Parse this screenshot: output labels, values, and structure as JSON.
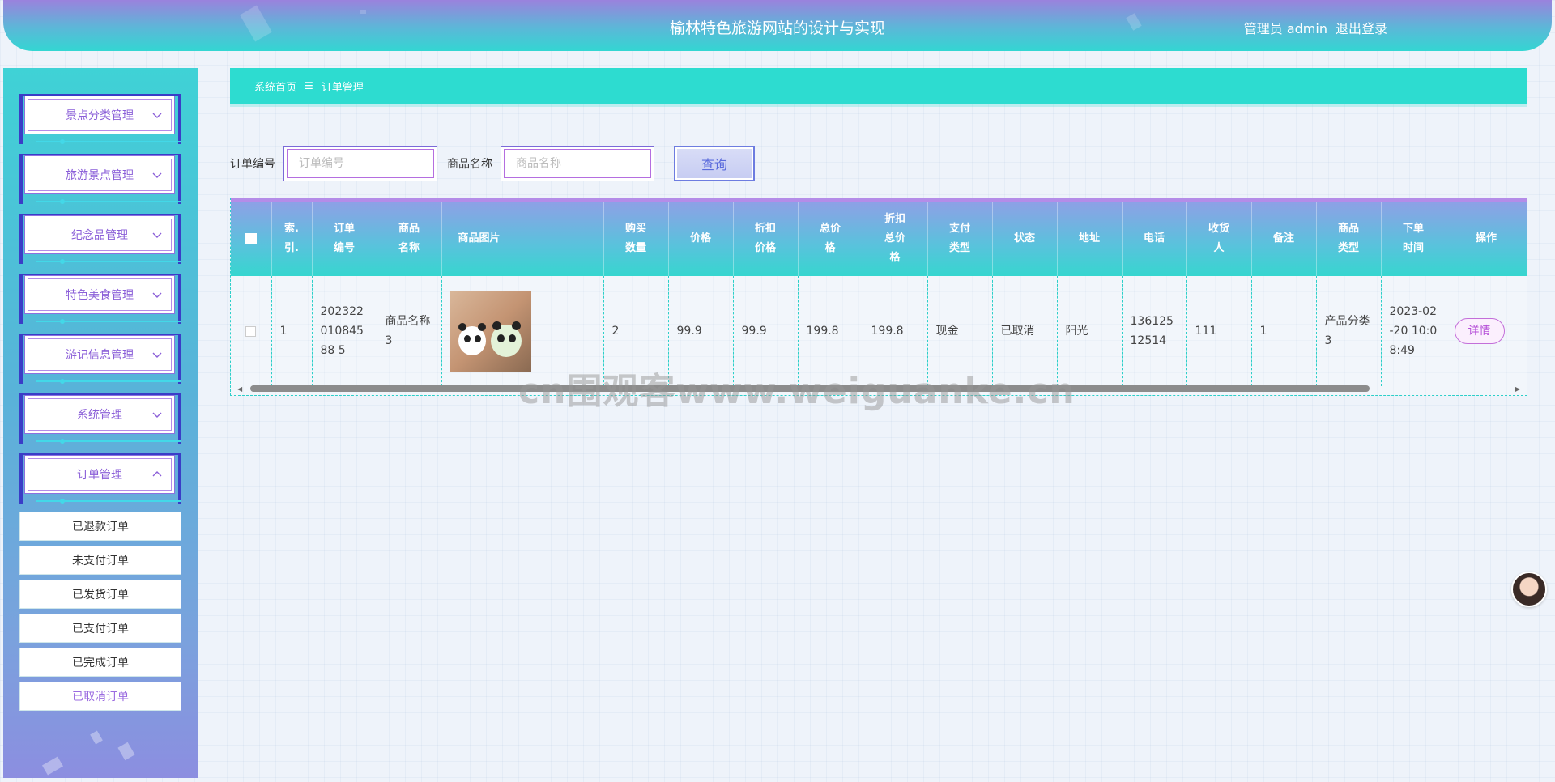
{
  "header": {
    "title": "榆林特色旅游网站的设计与实现",
    "user": "管理员 admin",
    "logout": "退出登录"
  },
  "sidebar": {
    "menus": [
      {
        "label": "景点分类管理",
        "expanded": false
      },
      {
        "label": "旅游景点管理",
        "expanded": false
      },
      {
        "label": "纪念品管理",
        "expanded": false
      },
      {
        "label": "特色美食管理",
        "expanded": false
      },
      {
        "label": "游记信息管理",
        "expanded": false
      },
      {
        "label": "系统管理",
        "expanded": false
      },
      {
        "label": "订单管理",
        "expanded": true
      }
    ],
    "submenu": [
      {
        "label": "已退款订单",
        "active": false
      },
      {
        "label": "未支付订单",
        "active": false
      },
      {
        "label": "已发货订单",
        "active": false
      },
      {
        "label": "已支付订单",
        "active": false
      },
      {
        "label": "已完成订单",
        "active": false
      },
      {
        "label": "已取消订单",
        "active": true
      }
    ]
  },
  "breadcrumb": {
    "home": "系统首页",
    "separator": "☰",
    "current": "订单管理"
  },
  "search": {
    "order_no_label": "订单编号",
    "order_no_placeholder": "订单编号",
    "product_name_label": "商品名称",
    "product_name_placeholder": "商品名称",
    "button": "查询"
  },
  "table": {
    "headers": [
      "",
      "索引",
      "订单编号",
      "商品名称",
      "商品图片",
      "购买数量",
      "价格",
      "折扣价格",
      "总价格",
      "折扣总价格",
      "支付类型",
      "状态",
      "地址",
      "电话",
      "收货人",
      "备注",
      "商品类型",
      "下单时间",
      "操作"
    ],
    "rows": [
      {
        "index": "1",
        "order_no": "20232201084588 5",
        "product_name": "商品名称3",
        "quantity": "2",
        "price": "99.9",
        "discount_price": "99.9",
        "total_price": "199.8",
        "discount_total": "199.8",
        "pay_type": "现金",
        "status": "已取消",
        "address": "阳光",
        "phone": "13612512514",
        "receiver": "111",
        "remark": "1",
        "product_type": "产品分类3",
        "order_time": "2023-02-20 10:08:49",
        "action": "详情"
      }
    ]
  },
  "watermark": "cn围观客www.weiguanke.cn",
  "colors": {
    "accent_teal": "#2ddcd0",
    "accent_purple": "#8b5fd8",
    "detail_button": "#b54fd8"
  }
}
